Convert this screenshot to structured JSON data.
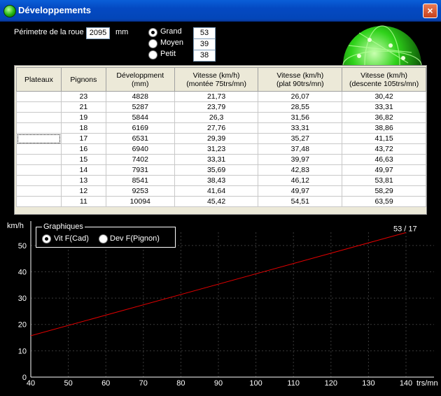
{
  "window": {
    "title": "Développements",
    "close_label": "×"
  },
  "controls": {
    "perimeter_label": "Périmetre de la roue :",
    "perimeter_value": "2095",
    "perimeter_unit": "mm",
    "plateaux": [
      {
        "label": "Grand",
        "value": "53",
        "selected": true
      },
      {
        "label": "Moyen",
        "value": "39",
        "selected": false
      },
      {
        "label": "Petit",
        "value": "38",
        "selected": false
      }
    ]
  },
  "table": {
    "headers": [
      "Plateaux",
      "Pignons",
      "Développment\n(mm)",
      "Vitesse (km/h)\n(montée 75trs/mn)",
      "Vitesse (km/h)\n(plat 90trs/mn)",
      "Vitesse (km/h)\n(descente 105trs/mn)"
    ],
    "rows": [
      [
        "",
        "23",
        "4828",
        "21,73",
        "26,07",
        "30,42"
      ],
      [
        "",
        "21",
        "5287",
        "23,79",
        "28,55",
        "33,31"
      ],
      [
        "",
        "19",
        "5844",
        "26,3",
        "31,56",
        "36,82"
      ],
      [
        "",
        "18",
        "6169",
        "27,76",
        "33,31",
        "38,86"
      ],
      [
        "",
        "17",
        "6531",
        "29,39",
        "35,27",
        "41,15"
      ],
      [
        "",
        "16",
        "6940",
        "31,23",
        "37,48",
        "43,72"
      ],
      [
        "",
        "15",
        "7402",
        "33,31",
        "39,97",
        "46,63"
      ],
      [
        "",
        "14",
        "7931",
        "35,69",
        "42,83",
        "49,97"
      ],
      [
        "",
        "13",
        "8541",
        "38,43",
        "46,12",
        "53,81"
      ],
      [
        "",
        "12",
        "9253",
        "41,64",
        "49,97",
        "58,29"
      ],
      [
        "",
        "11",
        "10094",
        "45,42",
        "54,51",
        "63,59"
      ]
    ],
    "selected_row": 4
  },
  "graph_options": {
    "title": "Graphiques",
    "options": [
      {
        "label": "Vit F(Cad)",
        "selected": true
      },
      {
        "label": "Dev F(Pignon)",
        "selected": false
      }
    ]
  },
  "chart_data": {
    "type": "line",
    "ylabel": "km/h",
    "xlabel": "trs/mn",
    "xlim": [
      40,
      140
    ],
    "ylim": [
      0,
      55
    ],
    "x_ticks": [
      40,
      50,
      60,
      70,
      80,
      90,
      100,
      110,
      120,
      130,
      140
    ],
    "y_ticks": [
      0,
      10,
      20,
      30,
      40,
      50
    ],
    "grid": true,
    "series": [
      {
        "name": "53 / 17",
        "color": "#e00000",
        "x": [
          40,
          140
        ],
        "y": [
          15.7,
          54.9
        ]
      }
    ]
  }
}
